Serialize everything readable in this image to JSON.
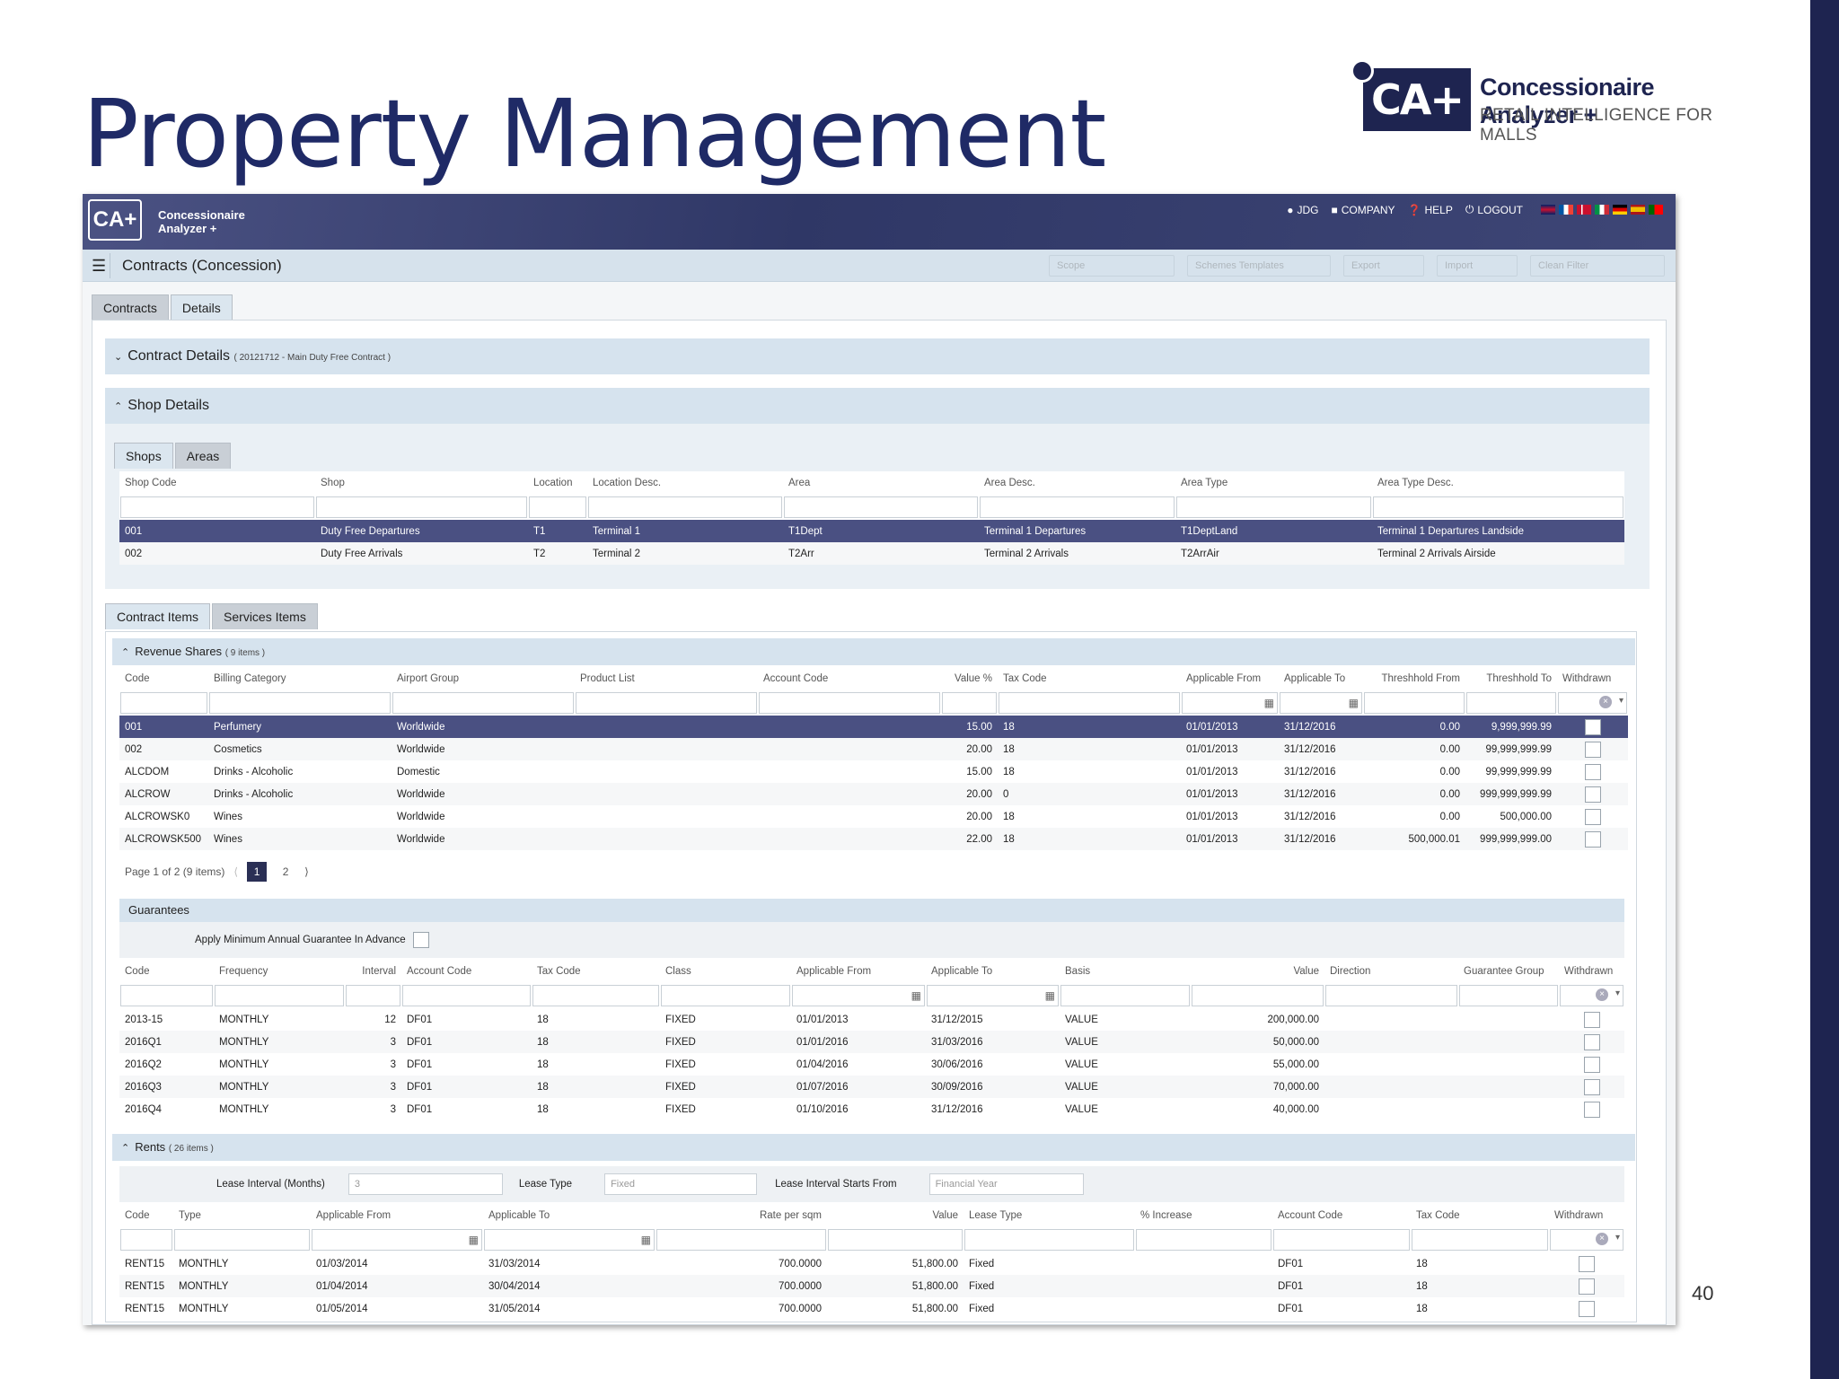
{
  "slide": {
    "title": "Property Management",
    "page_number": "40"
  },
  "brand": {
    "box": "CA+",
    "name": "Concessionaire Analyzer +",
    "tagline": "RETAIL INTELLIGENCE FOR MALLS"
  },
  "app": {
    "logo": "CA+",
    "logo_text": "Concessionaire Analyzer +",
    "top_links": [
      "JDG",
      "COMPANY",
      "HELP",
      "LOGOUT"
    ],
    "page_title": "Contracts (Concession)",
    "ghost_tools": [
      "Scope",
      "Schemes Templates",
      "Export",
      "Import",
      "Clean Filter"
    ],
    "main_tabs": [
      "Contracts",
      "Details"
    ],
    "contract_details": {
      "label": "Contract Details",
      "sub": "( 20121712 - Main Duty Free Contract )"
    },
    "shop_details": {
      "label": "Shop Details"
    },
    "shop_tabs": [
      "Shops",
      "Areas"
    ],
    "shops": {
      "headers": [
        "Shop Code",
        "Shop",
        "Location",
        "Location Desc.",
        "Area",
        "Area Desc.",
        "Area Type",
        "Area Type Desc."
      ],
      "rows": [
        [
          "001",
          "Duty Free Departures",
          "T1",
          "Terminal 1",
          "T1Dept",
          "Terminal 1 Departures",
          "T1DeptLand",
          "Terminal 1 Departures Landside"
        ],
        [
          "002",
          "Duty Free Arrivals",
          "T2",
          "Terminal 2",
          "T2Arr",
          "Terminal 2 Arrivals",
          "T2ArrAir",
          "Terminal 2 Arrivals Airside"
        ]
      ]
    },
    "item_tabs": [
      "Contract Items",
      "Services Items"
    ],
    "revenue": {
      "label": "Revenue Shares",
      "sub": "( 9 items )",
      "headers": [
        "Code",
        "Billing Category",
        "Airport Group",
        "Product List",
        "Account Code",
        "Value %",
        "Tax Code",
        "Applicable From",
        "Applicable To",
        "Threshhold From",
        "Threshhold To",
        "Withdrawn"
      ],
      "rows": [
        [
          "001",
          "Perfumery",
          "Worldwide",
          "",
          "",
          "15.00",
          "18",
          "01/01/2013",
          "31/12/2016",
          "0.00",
          "9,999,999.99"
        ],
        [
          "002",
          "Cosmetics",
          "Worldwide",
          "",
          "",
          "20.00",
          "18",
          "01/01/2013",
          "31/12/2016",
          "0.00",
          "99,999,999.99"
        ],
        [
          "ALCDOM",
          "Drinks - Alcoholic",
          "Domestic",
          "",
          "",
          "15.00",
          "18",
          "01/01/2013",
          "31/12/2016",
          "0.00",
          "99,999,999.99"
        ],
        [
          "ALCROW",
          "Drinks - Alcoholic",
          "Worldwide",
          "",
          "",
          "20.00",
          "0",
          "01/01/2013",
          "31/12/2016",
          "0.00",
          "999,999,999.99"
        ],
        [
          "ALCROWSK0",
          "Wines",
          "Worldwide",
          "",
          "",
          "20.00",
          "18",
          "01/01/2013",
          "31/12/2016",
          "0.00",
          "500,000.00"
        ],
        [
          "ALCROWSK500",
          "Wines",
          "Worldwide",
          "",
          "",
          "22.00",
          "18",
          "01/01/2013",
          "31/12/2016",
          "500,000.01",
          "999,999,999.00"
        ]
      ],
      "pager": {
        "summary": "Page 1 of 2 (9 items)",
        "pages": [
          "1",
          "2"
        ]
      }
    },
    "guarantees": {
      "label": "Guarantees",
      "advance_label": "Apply Minimum Annual Guarantee In Advance",
      "headers": [
        "Code",
        "Frequency",
        "Interval",
        "Account Code",
        "Tax Code",
        "Class",
        "Applicable From",
        "Applicable To",
        "Basis",
        "Value",
        "Direction",
        "Guarantee Group",
        "Withdrawn"
      ],
      "rows": [
        [
          "2013-15",
          "MONTHLY",
          "12",
          "DF01",
          "18",
          "FIXED",
          "01/01/2013",
          "31/12/2015",
          "VALUE",
          "200,000.00",
          "",
          ""
        ],
        [
          "2016Q1",
          "MONTHLY",
          "3",
          "DF01",
          "18",
          "FIXED",
          "01/01/2016",
          "31/03/2016",
          "VALUE",
          "50,000.00",
          "",
          ""
        ],
        [
          "2016Q2",
          "MONTHLY",
          "3",
          "DF01",
          "18",
          "FIXED",
          "01/04/2016",
          "30/06/2016",
          "VALUE",
          "55,000.00",
          "",
          ""
        ],
        [
          "2016Q3",
          "MONTHLY",
          "3",
          "DF01",
          "18",
          "FIXED",
          "01/07/2016",
          "30/09/2016",
          "VALUE",
          "70,000.00",
          "",
          ""
        ],
        [
          "2016Q4",
          "MONTHLY",
          "3",
          "DF01",
          "18",
          "FIXED",
          "01/10/2016",
          "31/12/2016",
          "VALUE",
          "40,000.00",
          "",
          ""
        ]
      ]
    },
    "rents": {
      "label": "Rents",
      "sub": "( 26 items )",
      "lease_interval_label": "Lease Interval (Months)",
      "lease_interval_value": "3",
      "lease_type_label": "Lease Type",
      "lease_type_value": "Fixed",
      "starts_from_label": "Lease Interval Starts From",
      "starts_from_value": "Financial Year",
      "headers": [
        "Code",
        "Type",
        "Applicable From",
        "Applicable To",
        "Rate per sqm",
        "Value",
        "Lease Type",
        "% Increase",
        "Account Code",
        "Tax Code",
        "Withdrawn"
      ],
      "rows": [
        [
          "RENT15",
          "MONTHLY",
          "01/03/2014",
          "31/03/2014",
          "700.0000",
          "51,800.00",
          "Fixed",
          "",
          "DF01",
          "18"
        ],
        [
          "RENT15",
          "MONTHLY",
          "01/04/2014",
          "30/04/2014",
          "700.0000",
          "51,800.00",
          "Fixed",
          "",
          "DF01",
          "18"
        ],
        [
          "RENT15",
          "MONTHLY",
          "01/05/2014",
          "31/05/2014",
          "700.0000",
          "51,800.00",
          "Fixed",
          "",
          "DF01",
          "18"
        ]
      ]
    }
  }
}
